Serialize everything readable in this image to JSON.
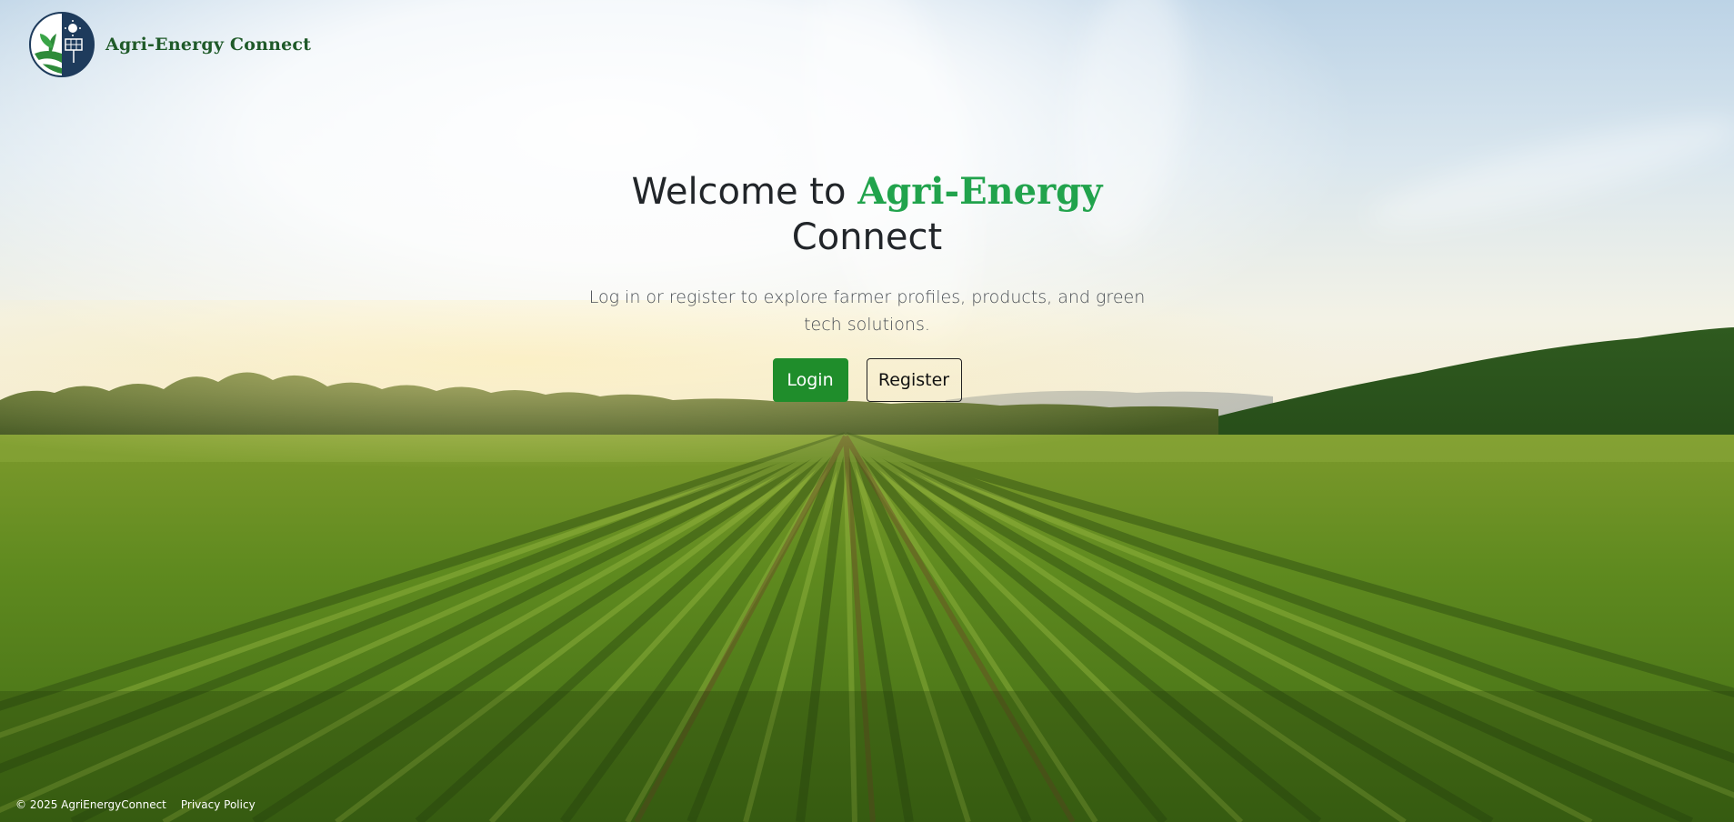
{
  "brand": {
    "name": "Agri-Energy Connect",
    "logo_icon": "sprout-solar-logo-icon"
  },
  "hero": {
    "title_prefix": "Welcome to",
    "title_accent": "Agri-Energy",
    "title_suffix": "Connect",
    "subtitle": "Log in or register to explore farmer profiles, products, and green tech solutions.",
    "login_label": "Login",
    "register_label": "Register"
  },
  "footer": {
    "copyright": "© 2025 AgriEnergyConnect",
    "privacy_label": "Privacy Policy"
  },
  "colors": {
    "accent_green": "#21a34c",
    "button_green": "#1f8d2b",
    "brand_text": "#1f5a29"
  }
}
